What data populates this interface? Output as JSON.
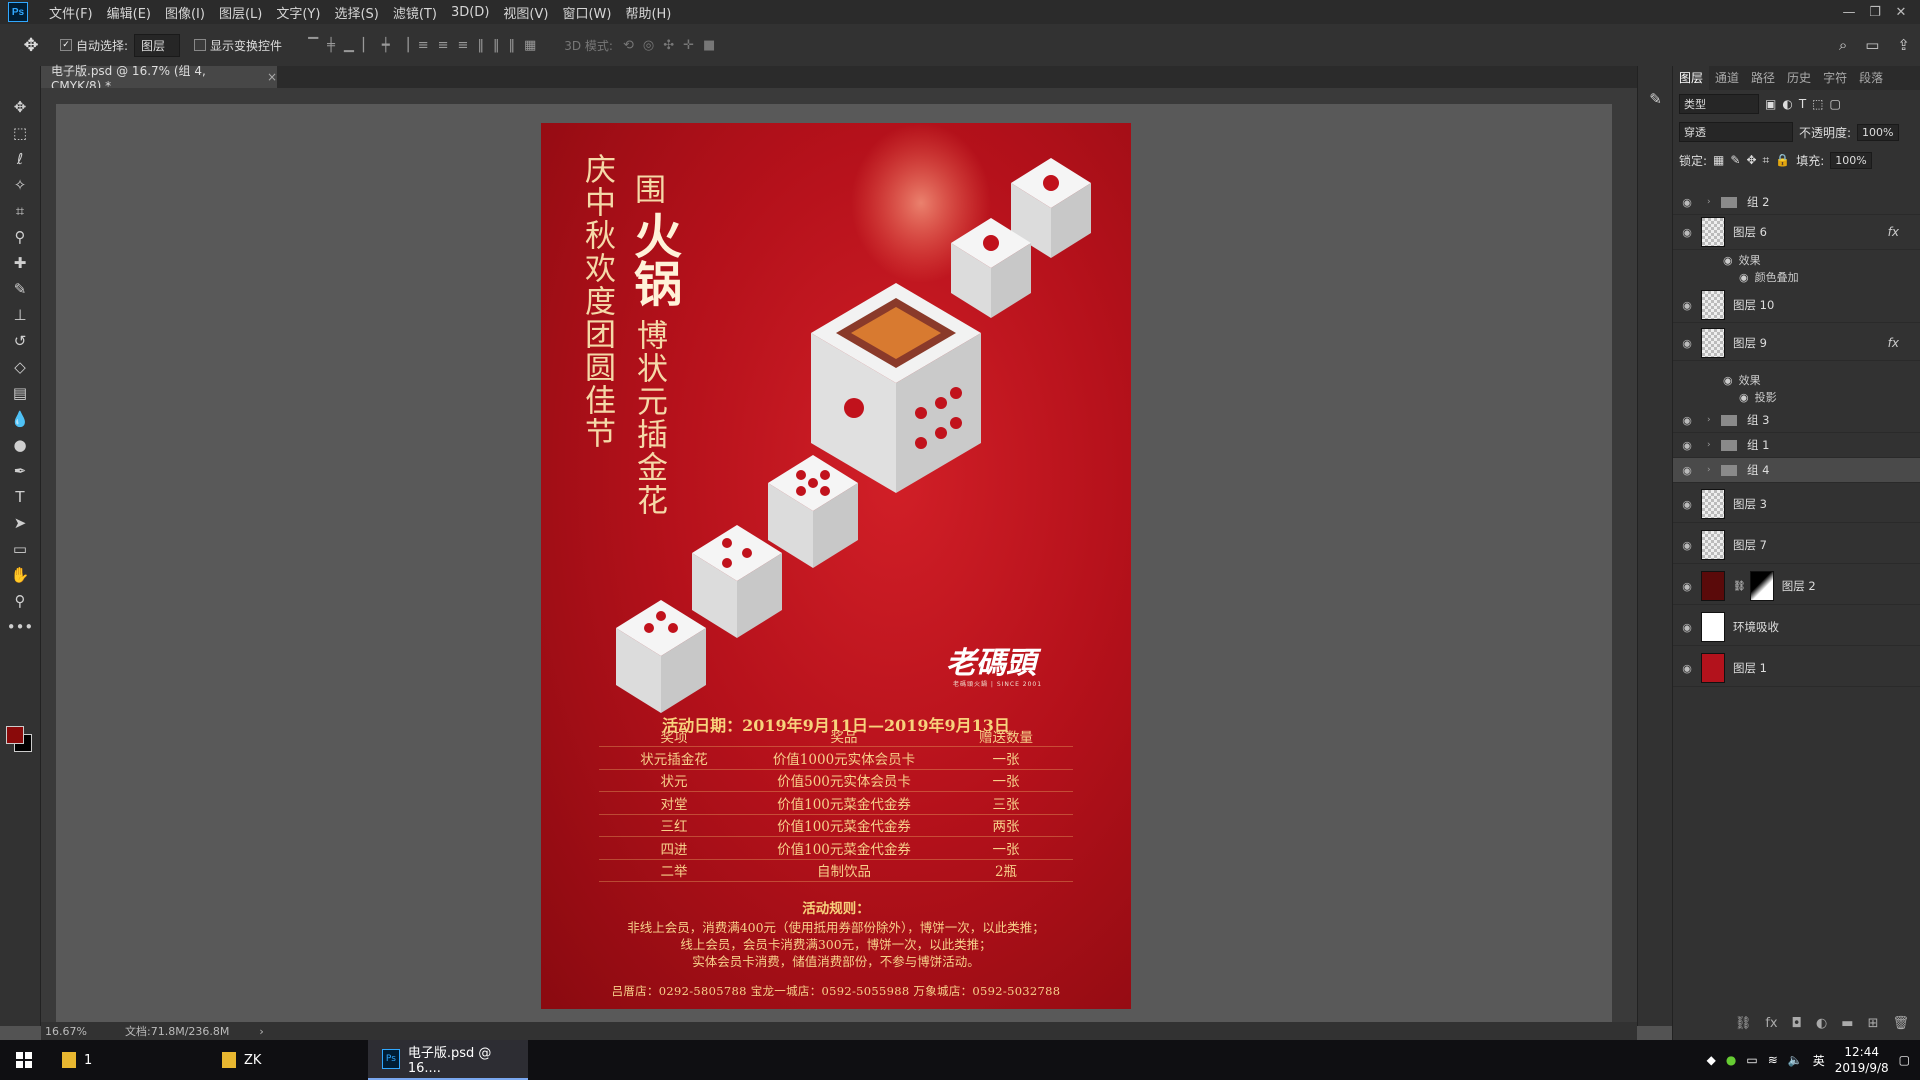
{
  "menu": {
    "app_icon": "Ps",
    "items": [
      "文件(F)",
      "编辑(E)",
      "图像(I)",
      "图层(L)",
      "文字(Y)",
      "选择(S)",
      "滤镜(T)",
      "3D(D)",
      "视图(V)",
      "窗口(W)",
      "帮助(H)"
    ],
    "window_controls": [
      "minimize-icon",
      "restore-icon",
      "close-icon"
    ]
  },
  "options": {
    "auto_select_label": "自动选择:",
    "auto_select_target": "图层",
    "show_transform_label": "显示变换控件",
    "mode3d_label": "3D 模式:"
  },
  "document": {
    "tab_title": "电子版.psd @ 16.7% (组 4, CMYK/8) *",
    "zoom": "16.67%",
    "doc_size": "文档:71.8M/236.8M"
  },
  "poster": {
    "vertical_left": "庆中秋欢度团圆佳节",
    "vertical_wei": "围",
    "vertical_big": "火锅",
    "vertical_right": "博状元插金花",
    "brand": "老碼頭",
    "brand_sub": "老碼頭火鍋 | SINCE 2001",
    "event_date": "活动日期：2019年9月11日—2019年9月13日",
    "prize_header": [
      "奖项",
      "奖品",
      "赠送数量"
    ],
    "prize_rows": [
      [
        "状元插金花",
        "价值1000元实体会员卡",
        "一张"
      ],
      [
        "状元",
        "价值500元实体会员卡",
        "一张"
      ],
      [
        "对堂",
        "价值100元菜金代金券",
        "三张"
      ],
      [
        "三红",
        "价值100元菜金代金券",
        "两张"
      ],
      [
        "四进",
        "价值100元菜金代金券",
        "一张"
      ],
      [
        "二举",
        "自制饮品",
        "2瓶"
      ]
    ],
    "rules_title": "活动规则：",
    "rules": [
      "非线上会员，消费满400元（使用抵用券部份除外），博饼一次，以此类推；",
      "线上会员，会员卡消费满300元，博饼一次，以此类推；",
      "实体会员卡消费，储值消费部份，不参与博饼活动。"
    ],
    "stores": "吕厝店：0292-5805788    宝龙一城店：0592-5055988    万象城店：0592-5032788"
  },
  "layers_panel": {
    "tabs": [
      "图层",
      "通道",
      "路径",
      "历史",
      "字符",
      "段落"
    ],
    "filter": "类型",
    "blend_mode": "穿透",
    "opacity_label": "不透明度:",
    "opacity": "100%",
    "lock_label": "锁定:",
    "fill_label": "填充:",
    "fill": "100%",
    "layers": [
      {
        "name": "组 2",
        "type": "group"
      },
      {
        "name": "图层 6",
        "type": "layer",
        "fx": true
      },
      {
        "name": "效果",
        "type": "effect-title"
      },
      {
        "name": "颜色叠加",
        "type": "effect"
      },
      {
        "name": "图层 10",
        "type": "layer"
      },
      {
        "name": "图层 9",
        "type": "layer",
        "fx": true
      },
      {
        "name": "效果",
        "type": "effect-title"
      },
      {
        "name": "投影",
        "type": "effect"
      },
      {
        "name": "组 3",
        "type": "group"
      },
      {
        "name": "组 1",
        "type": "group"
      },
      {
        "name": "组 4",
        "type": "group",
        "selected": true
      },
      {
        "name": "图层 3",
        "type": "layer"
      },
      {
        "name": "图层 7",
        "type": "layer"
      },
      {
        "name": "图层 2",
        "type": "layer"
      },
      {
        "name": "环境吸收",
        "type": "layer"
      },
      {
        "name": "图层 1",
        "type": "layer"
      }
    ],
    "fx_label": "fx"
  },
  "taskbar": {
    "items": [
      {
        "label": "1",
        "icon": "folder-icon"
      },
      {
        "label": "ZK",
        "icon": "folder-icon"
      },
      {
        "label": "电子版.psd @ 16....",
        "icon": "photoshop-icon"
      }
    ],
    "ime": "英",
    "time": "12:44",
    "date": "2019/9/8"
  },
  "colors": {
    "poster_red": "#c0141d",
    "accent_gold": "#f7d08a",
    "ps_blue": "#31a8ff"
  }
}
